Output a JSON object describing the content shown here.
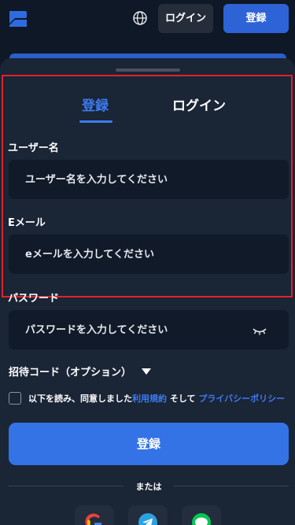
{
  "header": {
    "login_label": "ログイン",
    "register_label": "登録"
  },
  "tabs": {
    "register": "登録",
    "login": "ログイン"
  },
  "form": {
    "username": {
      "label": "ユーザー名",
      "placeholder": "ユーザー名を入力してください"
    },
    "email": {
      "label": "Eメール",
      "placeholder": "eメールを入力してください"
    },
    "password": {
      "label": "パスワード",
      "placeholder": "パスワードを入力してください"
    },
    "invite_label": "招待コード（オプション）",
    "agree_prefix": "以下を読み、同意しました",
    "terms_link": "利用規約",
    "agree_middle": " そして ",
    "privacy_link": "プライバシーポリシー",
    "submit_label": "登録",
    "or_label": "または"
  },
  "social": [
    "google-icon",
    "telegram-icon",
    "line-icon"
  ],
  "colors": {
    "accent": "#3d7cf0",
    "background": "#0f1826",
    "sheet": "#1a2536",
    "highlight_border": "#e0222a"
  }
}
